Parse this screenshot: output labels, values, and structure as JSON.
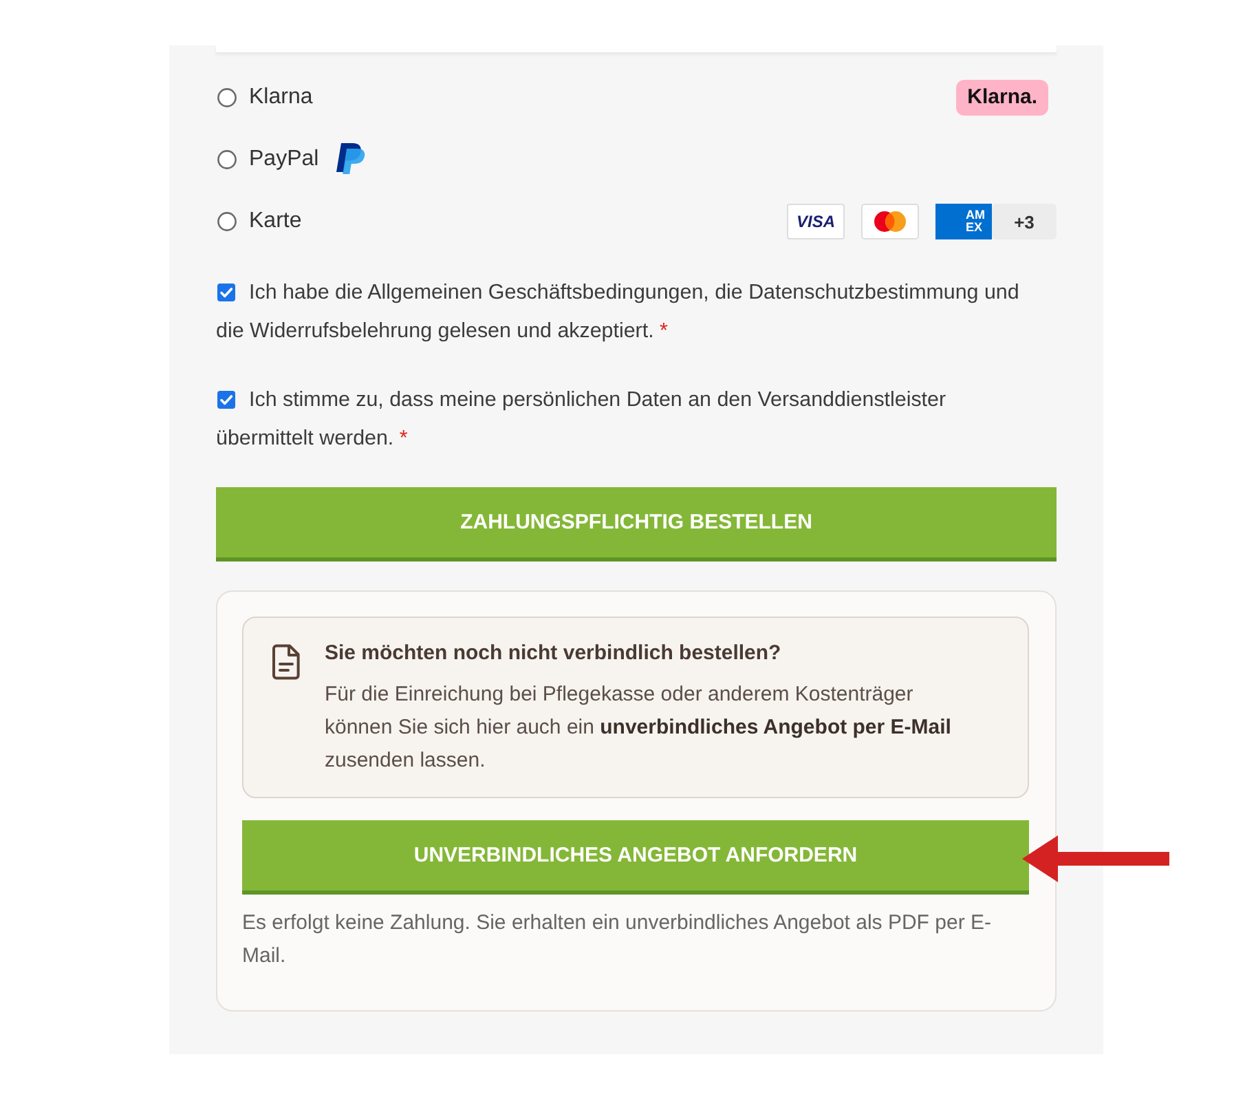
{
  "payment_methods": [
    {
      "kind": "klarna",
      "label": "Klarna",
      "selected": false,
      "badge": "Klarna."
    },
    {
      "kind": "paypal",
      "label": "PayPal",
      "selected": false
    },
    {
      "kind": "cards",
      "label": "Karte",
      "selected": false,
      "cards": [
        {
          "kind": "visa",
          "label": "VISA"
        },
        {
          "kind": "mastercard"
        },
        {
          "kind": "amex",
          "label": "AM EX"
        },
        {
          "kind": "more",
          "label": "+3"
        }
      ]
    }
  ],
  "consents": [
    {
      "text": "Ich habe die Allgemeinen Geschäftsbedingungen, die Datenschutzbestimmung und die Widerrufsbelehrung gelesen und akzeptiert.",
      "required_mark": "*",
      "checked": true
    },
    {
      "text": "Ich stimme zu, dass meine persönlichen Daten an den Versanddienstleister übermittelt werden.",
      "required_mark": "*",
      "checked": true
    }
  ],
  "order_button": {
    "label": "ZAHLUNGSPFLICHTIG BESTELLEN"
  },
  "offer": {
    "heading": "Sie möchten noch nicht verbindlich bestellen?",
    "text": "Für die Einreichung bei Pflegekasse oder anderem Kostenträger können Sie sich hier auch ein **unverbindliches Angebot per E-Mail** zusenden lassen.",
    "button": "UNVERBINDLICHES ANGEBOT ANFORDERN",
    "note": "Es erfolgt keine Zahlung. Sie erhalten ein unverbindliches Angebot als PDF per E-Mail."
  }
}
